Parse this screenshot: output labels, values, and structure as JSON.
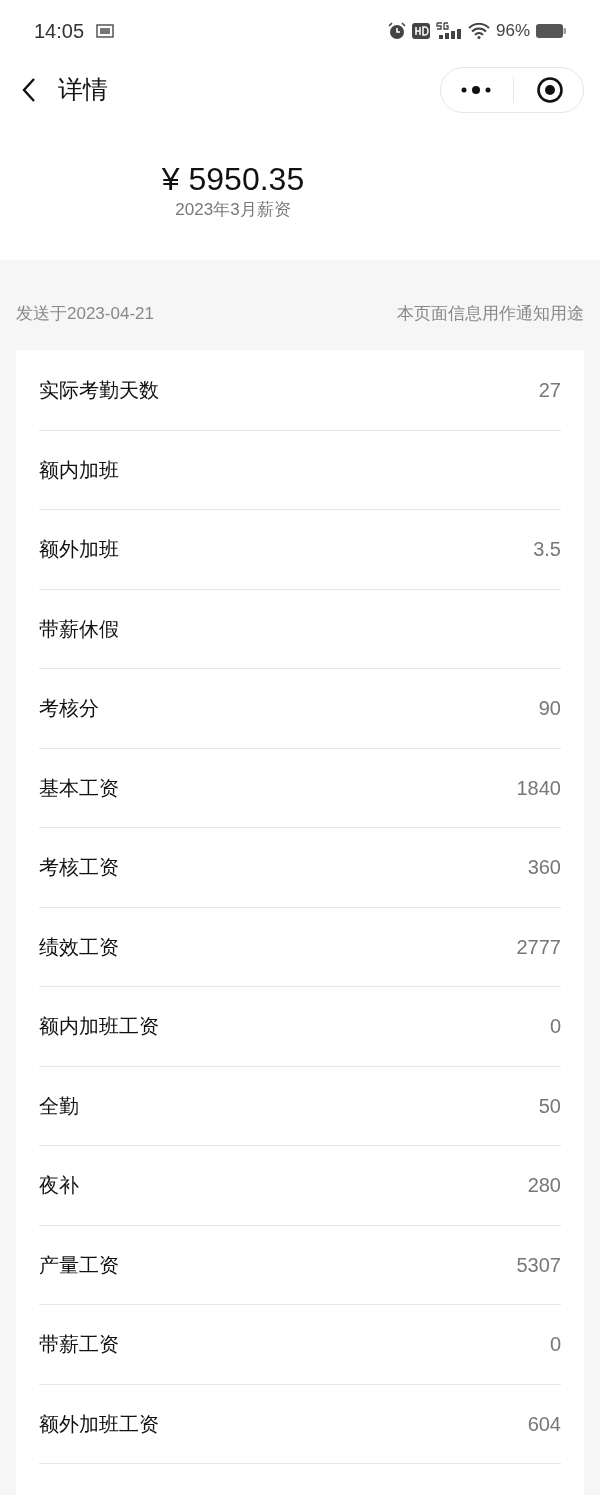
{
  "status_bar": {
    "time": "14:05",
    "battery": "96%"
  },
  "nav": {
    "title": "详情"
  },
  "summary": {
    "amount": "¥ 5950.35",
    "period": "2023年3月薪资"
  },
  "info": {
    "sent": "发送于2023-04-21",
    "note": "本页面信息用作通知用途"
  },
  "rows": [
    {
      "label": "实际考勤天数",
      "value": "27"
    },
    {
      "label": "额内加班",
      "value": ""
    },
    {
      "label": "额外加班",
      "value": "3.5"
    },
    {
      "label": "带薪休假",
      "value": ""
    },
    {
      "label": "考核分",
      "value": "90"
    },
    {
      "label": "基本工资",
      "value": "1840"
    },
    {
      "label": "考核工资",
      "value": "360"
    },
    {
      "label": "绩效工资",
      "value": "2777"
    },
    {
      "label": "额内加班工资",
      "value": "0"
    },
    {
      "label": "全勤",
      "value": "50"
    },
    {
      "label": "夜补",
      "value": "280"
    },
    {
      "label": "产量工资",
      "value": "5307"
    },
    {
      "label": "带薪工资",
      "value": "0"
    },
    {
      "label": "额外加班工资",
      "value": "604"
    }
  ]
}
